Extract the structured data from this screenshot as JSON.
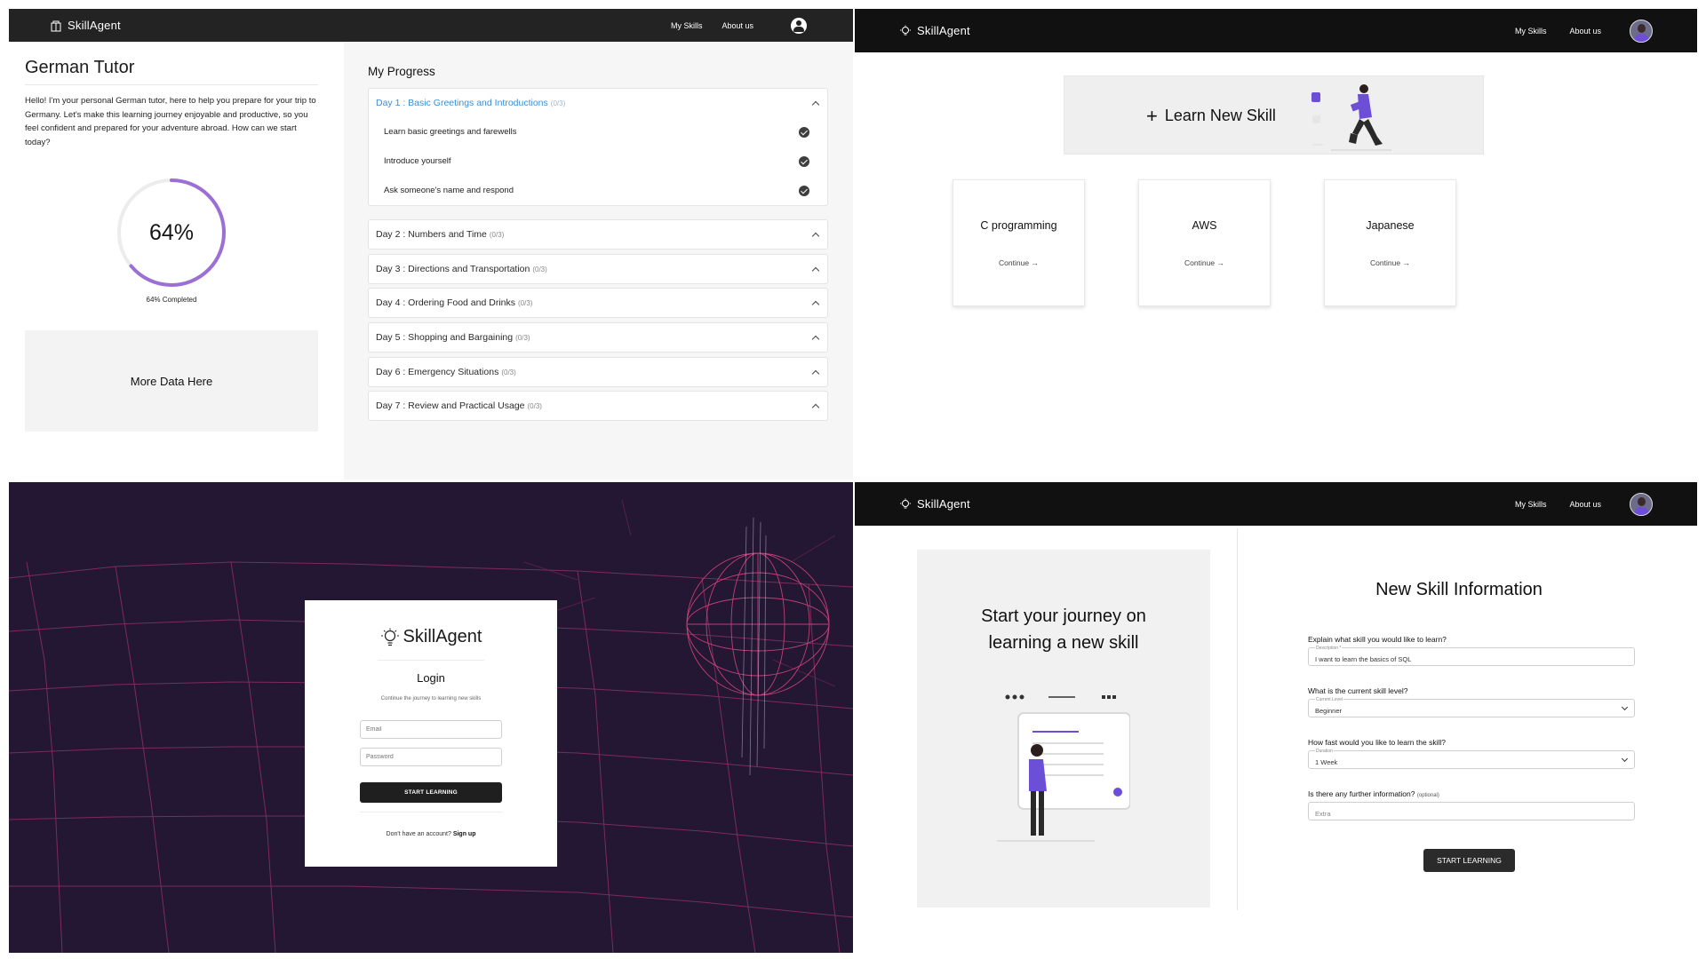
{
  "brand": "SkillAgent",
  "nav": {
    "my_skills": "My Skills",
    "about_us": "About us"
  },
  "tutor": {
    "title": "German Tutor",
    "intro": "Hello! I'm your personal German tutor, here to help you prepare for your trip to Germany. Let's make this learning journey enjoyable and productive, so you feel confident and prepared for your adventure abroad. How can we start today?",
    "progress_percent": 64,
    "progress_label": "64%",
    "progress_caption": "64% Completed",
    "more_box": "More Data Here",
    "colors": {
      "ring": "#9b6fd6",
      "ring_track": "#ececec",
      "active_day": "#3a8fd6"
    }
  },
  "progress": {
    "title": "My Progress",
    "days": [
      {
        "label": "Day 1 : Basic Greetings and Introductions",
        "count": "(0/3)",
        "open": true,
        "items": [
          "Learn basic greetings and farewells",
          "Introduce yourself",
          "Ask someone's name and respond"
        ]
      },
      {
        "label": "Day 2 : Numbers and Time",
        "count": "(0/3)"
      },
      {
        "label": "Day 3 : Directions and Transportation",
        "count": "(0/3)"
      },
      {
        "label": "Day 4 : Ordering Food and Drinks",
        "count": "(0/3)"
      },
      {
        "label": "Day 5 : Shopping and Bargaining",
        "count": "(0/3)"
      },
      {
        "label": "Day 6 : Emergency Situations",
        "count": "(0/3)"
      },
      {
        "label": "Day 7 : Review and Practical Usage",
        "count": "(0/3)"
      }
    ]
  },
  "skills_page": {
    "learn_new": "Learn New Skill",
    "skills": [
      {
        "name": "C programming",
        "action": "Continue"
      },
      {
        "name": "AWS",
        "action": "Continue"
      },
      {
        "name": "Japanese",
        "action": "Continue"
      }
    ]
  },
  "login": {
    "title": "Login",
    "subtitle": "Continue the journey to learning new skills",
    "email_placeholder": "Email",
    "password_placeholder": "Password",
    "button": "START LEARNING",
    "signup_prompt": "Don't have an account?",
    "signup_link": "Sign up",
    "colors": {
      "background": "#231733",
      "grid_line": "#c23a7a"
    }
  },
  "new_skill": {
    "hero": [
      "Start your journey on",
      "learning a new skill"
    ],
    "title": "New Skill Information",
    "q1": "Explain what skill you would like to learn?",
    "q1_label": "Description *",
    "q1_value": "I want to learn the basics of SQL",
    "q2": "What is the current skill level?",
    "q2_label": "Current Level",
    "q2_value": "Beginner",
    "q3": "How fast would you like to learn the skill?",
    "q3_label": "Duration",
    "q3_value": "1 Week",
    "q4": "Is there any further information?",
    "q4_optional": "(optional)",
    "q4_placeholder": "Extra",
    "button": "START LEARNING"
  }
}
